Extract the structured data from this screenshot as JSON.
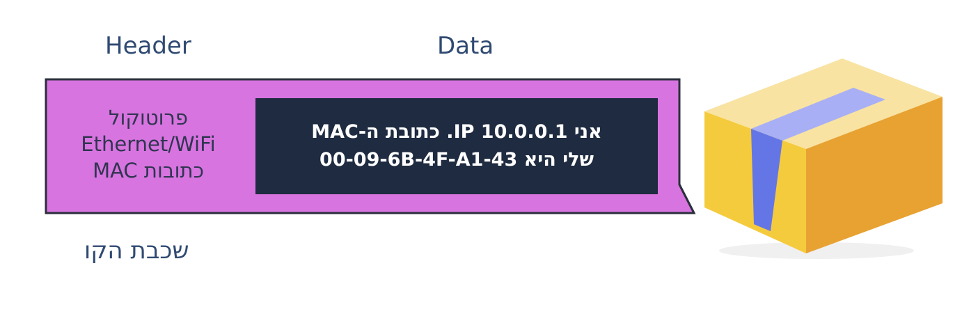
{
  "labels": {
    "header": "Header",
    "data": "Data",
    "layer": "שכבת הקו"
  },
  "header_box": {
    "line1": "פרוטוקול",
    "line2": "Ethernet/WiFi",
    "line3": "כתובות MAC"
  },
  "data_box": {
    "line1": "אני IP 10.0.0.1. כתובת ה-MAC",
    "line2": "שלי היא 00-09-6B-4F-A1-43"
  },
  "colors": {
    "envelope": "#d874e0",
    "data_box": "#1e2b40",
    "label_text": "#2f4a72",
    "box_top": "#f8e3a2",
    "box_left": "#f5cb3e",
    "box_right": "#e8a232",
    "tape": "#6476e6"
  },
  "icons": {
    "package": "package-icon"
  }
}
